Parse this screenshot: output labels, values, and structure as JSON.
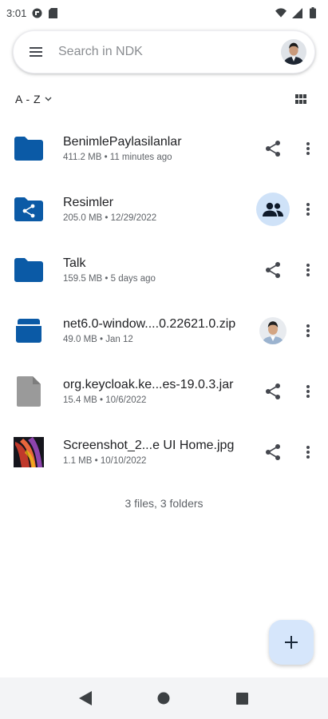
{
  "status_bar": {
    "time": "3:01"
  },
  "search": {
    "placeholder": "Search in NDK"
  },
  "sort": {
    "label": "A - Z"
  },
  "colors": {
    "accent": "#0b57a0",
    "folder": "#0b5aa6",
    "fab_bg": "#d6e6fb",
    "share_bg": "#cfe2f8"
  },
  "files": [
    {
      "name": "BenimlePaylasilanlar",
      "meta": "411.2 MB • 11 minutes ago",
      "icon": "folder-icon",
      "action": "share-icon"
    },
    {
      "name": "Resimler",
      "meta": "205.0 MB • 12/29/2022",
      "icon": "shared-folder-icon",
      "action": "people-icon"
    },
    {
      "name": "Talk",
      "meta": "159.5 MB • 5 days ago",
      "icon": "folder-icon",
      "action": "share-icon"
    },
    {
      "name": "net6.0-window....0.22621.0.zip",
      "meta": "49.0 MB • Jan 12",
      "icon": "archive-icon",
      "action": "owner-avatar"
    },
    {
      "name": "org.keycloak.ke...es-19.0.3.jar",
      "meta": "15.4 MB • 10/6/2022",
      "icon": "file-icon",
      "action": "share-icon"
    },
    {
      "name": "Screenshot_2...e UI Home.jpg",
      "meta": "1.1 MB • 10/10/2022",
      "icon": "image-thumbnail",
      "action": "share-icon"
    }
  ],
  "summary": "3 files, 3 folders"
}
